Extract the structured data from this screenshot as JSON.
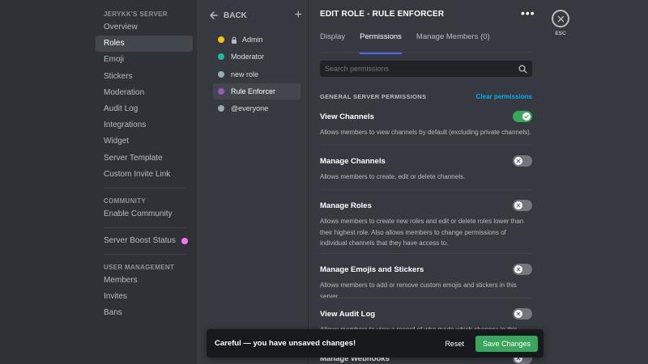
{
  "sidebar": {
    "server_heading": "JERYKK'S SERVER",
    "server_items": [
      {
        "label": "Overview"
      },
      {
        "label": "Roles"
      },
      {
        "label": "Emoji"
      },
      {
        "label": "Stickers"
      },
      {
        "label": "Moderation"
      },
      {
        "label": "Audit Log"
      },
      {
        "label": "Integrations"
      },
      {
        "label": "Widget"
      },
      {
        "label": "Server Template"
      },
      {
        "label": "Custom Invite Link"
      }
    ],
    "community_heading": "COMMUNITY",
    "community_items": [
      {
        "label": "Enable Community"
      }
    ],
    "boost_label": "Server Boost Status",
    "user_mgmt_heading": "USER MANAGEMENT",
    "user_mgmt_items": [
      {
        "label": "Members"
      },
      {
        "label": "Invites"
      },
      {
        "label": "Bans"
      }
    ]
  },
  "roles_panel": {
    "back_label": "BACK",
    "roles": [
      {
        "name": "Admin",
        "color": "#f1c40f"
      },
      {
        "name": "Moderator",
        "color": "#1abc9c"
      },
      {
        "name": "new role",
        "color": "#99aab5"
      },
      {
        "name": "Rule Enforcer",
        "color": "#9b59b6"
      },
      {
        "name": "@everyone",
        "color": "#99aab5"
      }
    ]
  },
  "editor": {
    "title": "EDIT ROLE - RULE ENFORCER",
    "tabs": [
      {
        "label": "Display"
      },
      {
        "label": "Permissions"
      },
      {
        "label": "Manage Members (0)"
      }
    ],
    "search_placeholder": "Search permissions",
    "section_title": "GENERAL SERVER PERMISSIONS",
    "clear_label": "Clear permissions",
    "permissions": [
      {
        "name": "View Channels",
        "desc": "Allows members to view channels by default (excluding private channels).",
        "enabled": true
      },
      {
        "name": "Manage Channels",
        "desc": "Allows members to create, edit or delete channels.",
        "enabled": false
      },
      {
        "name": "Manage Roles",
        "desc": "Allows members to create new roles and edit or delete roles lower than their highest role. Also allows members to change permissions of individual channels that they have access to.",
        "enabled": false
      },
      {
        "name": "Manage Emojis and Stickers",
        "desc": "Allows members to add or remove custom emojis and stickers in this server.",
        "enabled": false
      },
      {
        "name": "View Audit Log",
        "desc": "Allows members to view a record of who made which changes in this server.",
        "enabled": false
      },
      {
        "name": "Manage Webhooks",
        "desc": "",
        "enabled": false
      }
    ]
  },
  "esc": {
    "label": "ESC"
  },
  "unsaved_bar": {
    "message": "Careful — you have unsaved changes!",
    "reset_label": "Reset",
    "save_label": "Save Changes"
  },
  "colors": {
    "accent": "#5865f2",
    "toggle_on": "#3ba55d",
    "link": "#00aff4",
    "boost": "#ff73fa"
  },
  "icons": {
    "back": "arrow-left-icon",
    "add": "plus-icon",
    "more": "more-icon",
    "search": "search-icon",
    "close": "close-icon",
    "lock": "lock-icon",
    "check": "check-icon",
    "x": "x-icon"
  }
}
